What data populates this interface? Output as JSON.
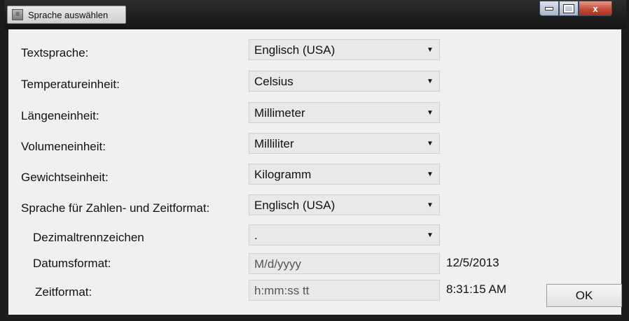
{
  "window": {
    "title": "Sprache auswählen",
    "close_glyph": "x"
  },
  "form": {
    "rows": [
      {
        "label": "Textsprache:",
        "value": "Englisch (USA)"
      },
      {
        "label": "Temperatureinheit:",
        "value": "Celsius"
      },
      {
        "label": "Längeneinheit:",
        "value": "Millimeter"
      },
      {
        "label": "Volumeneinheit:",
        "value": "Milliliter"
      },
      {
        "label": "Gewichtseinheit:",
        "value": "Kilogramm"
      },
      {
        "label": "Sprache für Zahlen- und Zeitformat:",
        "value": "Englisch (USA)"
      },
      {
        "label": "Dezimaltrennzeichen",
        "value": "."
      }
    ],
    "date_format": {
      "label": "Datumsformat:",
      "value": "M/d/yyyy",
      "preview": "12/5/2013"
    },
    "time_format": {
      "label": "Zeitformat:",
      "value": "h:mm:ss tt",
      "preview": "8:31:15 AM"
    },
    "ok_label": "OK"
  },
  "icons": {
    "app": "app-icon",
    "dropdown": "dropdown-arrow-icon",
    "minimize": "minimize-icon",
    "maximize": "maximize-icon",
    "close": "close-icon"
  }
}
